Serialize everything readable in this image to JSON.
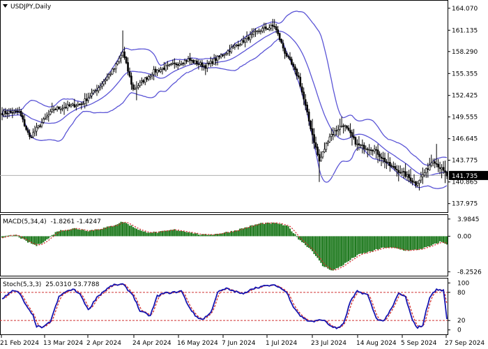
{
  "window": {
    "symbol_title": "USDJPY,Daily",
    "menu_icon": "triangle-down-icon"
  },
  "colors": {
    "candle": "#000000",
    "bollinger": "#5b55d6",
    "macd_hist": "#1f7a1f",
    "macd_signal": "#d03030",
    "stoch_main": "#1515b0",
    "stoch_signal": "#d03030",
    "level_line": "#d03030",
    "grid_border": "#000000",
    "price_line": "#b0b0b0",
    "price_label_bg": "#000000",
    "price_label_text": "#ffffff"
  },
  "chart_data": [
    {
      "type": "candlestick",
      "title": "USDJPY,Daily",
      "current_price": "141.735",
      "y_ticks": [
        "164.070",
        "161.135",
        "158.290",
        "155.355",
        "152.425",
        "149.555",
        "146.645",
        "143.775",
        "140.865",
        "137.975"
      ],
      "ylim": [
        137.2,
        164.8
      ],
      "x_ticks": [
        "21 Feb 2024",
        "13 Mar 2024",
        "2 Apr 2024",
        "24 Apr 2024",
        "16 May 2024",
        "7 Jun 2024",
        "1 Jul 2024",
        "23 Jul 2024",
        "14 Aug 2024",
        "5 Sep 2024",
        "27 Sep 2024"
      ],
      "close_anchors": [
        [
          0,
          150.1
        ],
        [
          10,
          150.2
        ],
        [
          16,
          146.8
        ],
        [
          22,
          148.5
        ],
        [
          30,
          150.6
        ],
        [
          46,
          151.3
        ],
        [
          56,
          153.5
        ],
        [
          65,
          156.0
        ],
        [
          70,
          158.2
        ],
        [
          76,
          153.2
        ],
        [
          88,
          155.6
        ],
        [
          108,
          157.2
        ],
        [
          118,
          156.3
        ],
        [
          135,
          159.0
        ],
        [
          150,
          161.2
        ],
        [
          158,
          161.7
        ],
        [
          164,
          158.2
        ],
        [
          172,
          154.8
        ],
        [
          178,
          149.0
        ],
        [
          184,
          143.6
        ],
        [
          190,
          147.0
        ],
        [
          198,
          148.6
        ],
        [
          206,
          145.8
        ],
        [
          216,
          145.2
        ],
        [
          224,
          143.2
        ],
        [
          234,
          141.8
        ],
        [
          240,
          140.6
        ],
        [
          246,
          142.4
        ],
        [
          250,
          143.9
        ],
        [
          254,
          142.8
        ],
        [
          258,
          141.7
        ]
      ],
      "bollinger_bands": "Bollinger Bands (20, 2)"
    },
    {
      "type": "bar",
      "title": "MACD(5,34,4)",
      "values_text": "-1.8261 -1.4247",
      "y_ticks": [
        "3.9845",
        "0.00",
        "-8.2526"
      ],
      "ylim": [
        -9.0,
        4.6
      ],
      "hist_anchors": [
        [
          0,
          -0.2
        ],
        [
          8,
          0.3
        ],
        [
          14,
          -1.2
        ],
        [
          20,
          -2.2
        ],
        [
          26,
          -0.8
        ],
        [
          32,
          1.2
        ],
        [
          42,
          1.8
        ],
        [
          50,
          1.3
        ],
        [
          58,
          1.8
        ],
        [
          64,
          2.4
        ],
        [
          70,
          3.4
        ],
        [
          76,
          2.2
        ],
        [
          82,
          1.0
        ],
        [
          90,
          0.9
        ],
        [
          100,
          1.5
        ],
        [
          108,
          1.0
        ],
        [
          116,
          0.3
        ],
        [
          124,
          0.5
        ],
        [
          134,
          1.2
        ],
        [
          142,
          2.1
        ],
        [
          150,
          3.0
        ],
        [
          160,
          3.0
        ],
        [
          166,
          2.2
        ],
        [
          172,
          -0.6
        ],
        [
          180,
          -3.4
        ],
        [
          186,
          -6.9
        ],
        [
          192,
          -8.0
        ],
        [
          198,
          -6.6
        ],
        [
          206,
          -4.4
        ],
        [
          214,
          -3.5
        ],
        [
          222,
          -2.6
        ],
        [
          228,
          -2.8
        ],
        [
          234,
          -3.3
        ],
        [
          240,
          -3.2
        ],
        [
          248,
          -2.4
        ],
        [
          254,
          -1.3
        ],
        [
          258,
          -1.8
        ]
      ]
    },
    {
      "type": "line",
      "title": "Stoch(5,3,3)",
      "values_text": "25.0310 53.7788",
      "y_ticks": [
        "100",
        "80",
        "20",
        "0"
      ],
      "levels": [
        80,
        20
      ],
      "ylim": [
        -5,
        105
      ],
      "main_anchors": [
        [
          0,
          65
        ],
        [
          6,
          85
        ],
        [
          10,
          78
        ],
        [
          15,
          45
        ],
        [
          18,
          30
        ],
        [
          20,
          8
        ],
        [
          24,
          5
        ],
        [
          28,
          18
        ],
        [
          33,
          70
        ],
        [
          37,
          82
        ],
        [
          42,
          86
        ],
        [
          46,
          72
        ],
        [
          50,
          42
        ],
        [
          55,
          70
        ],
        [
          60,
          85
        ],
        [
          64,
          95
        ],
        [
          70,
          97
        ],
        [
          76,
          74
        ],
        [
          80,
          40
        ],
        [
          86,
          30
        ],
        [
          90,
          72
        ],
        [
          94,
          78
        ],
        [
          100,
          80
        ],
        [
          104,
          83
        ],
        [
          108,
          52
        ],
        [
          112,
          30
        ],
        [
          116,
          22
        ],
        [
          121,
          36
        ],
        [
          125,
          80
        ],
        [
          130,
          88
        ],
        [
          135,
          82
        ],
        [
          140,
          76
        ],
        [
          144,
          87
        ],
        [
          150,
          92
        ],
        [
          156,
          95
        ],
        [
          160,
          93
        ],
        [
          165,
          80
        ],
        [
          169,
          50
        ],
        [
          173,
          30
        ],
        [
          177,
          20
        ],
        [
          181,
          18
        ],
        [
          186,
          22
        ],
        [
          190,
          10
        ],
        [
          194,
          3
        ],
        [
          198,
          12
        ],
        [
          202,
          60
        ],
        [
          206,
          82
        ],
        [
          212,
          75
        ],
        [
          217,
          25
        ],
        [
          221,
          18
        ],
        [
          226,
          45
        ],
        [
          230,
          78
        ],
        [
          234,
          70
        ],
        [
          238,
          20
        ],
        [
          241,
          5
        ],
        [
          244,
          10
        ],
        [
          248,
          70
        ],
        [
          252,
          86
        ],
        [
          256,
          84
        ],
        [
          258,
          25
        ]
      ]
    }
  ]
}
